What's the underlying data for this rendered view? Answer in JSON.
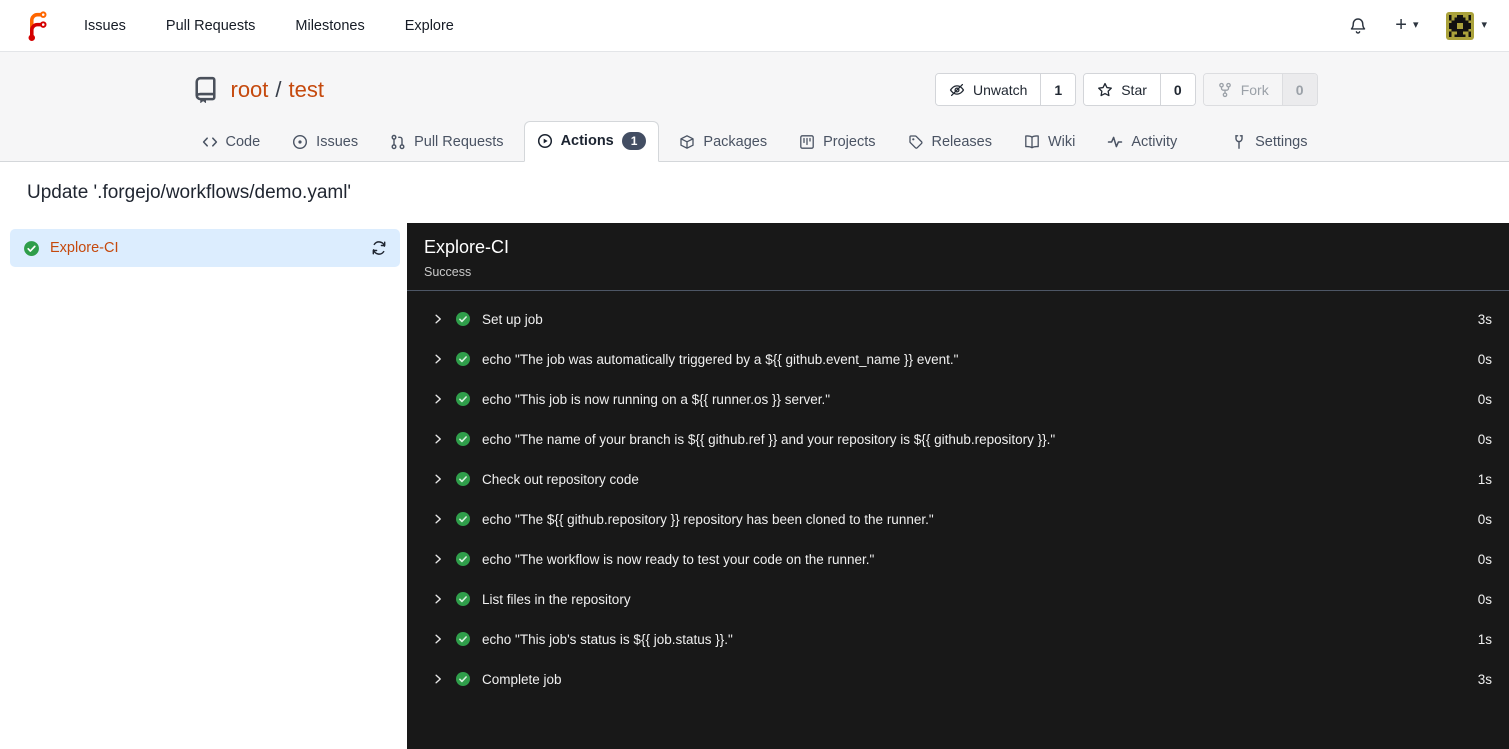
{
  "navbar": {
    "links": {
      "issues": "Issues",
      "pull_requests": "Pull Requests",
      "milestones": "Milestones",
      "explore": "Explore"
    }
  },
  "icons": {
    "plus": "+",
    "caret_down": "▾",
    "logo": "forgejo-logo",
    "bell": "notifications-bell",
    "avatar": "user-identicon"
  },
  "repo_header": {
    "owner": "root",
    "slash": "/",
    "name": "test",
    "unwatch": {
      "label": "Unwatch",
      "count": "1"
    },
    "star": {
      "label": "Star",
      "count": "0"
    },
    "fork": {
      "label": "Fork",
      "count": "0"
    }
  },
  "tabs": {
    "code": "Code",
    "issues": "Issues",
    "pull_requests": "Pull Requests",
    "actions": "Actions",
    "actions_badge": "1",
    "packages": "Packages",
    "projects": "Projects",
    "releases": "Releases",
    "wiki": "Wiki",
    "activity": "Activity",
    "settings": "Settings"
  },
  "page": {
    "title": "Update '.forgejo/workflows/demo.yaml'"
  },
  "sidebar": {
    "job_name": "Explore-CI"
  },
  "panel": {
    "title": "Explore-CI",
    "status": "Success",
    "steps": [
      {
        "name": "Set up job",
        "duration": "3s"
      },
      {
        "name": "echo \"The job was automatically triggered by a ${{ github.event_name }} event.\"",
        "duration": "0s"
      },
      {
        "name": "echo \"This job is now running on a ${{ runner.os }} server.\"",
        "duration": "0s"
      },
      {
        "name": "echo \"The name of your branch is ${{ github.ref }} and your repository is ${{ github.repository }}.\"",
        "duration": "0s"
      },
      {
        "name": "Check out repository code",
        "duration": "1s"
      },
      {
        "name": "echo \"The ${{ github.repository }} repository has been cloned to the runner.\"",
        "duration": "0s"
      },
      {
        "name": "echo \"The workflow is now ready to test your code on the runner.\"",
        "duration": "0s"
      },
      {
        "name": "List files in the repository",
        "duration": "0s"
      },
      {
        "name": "echo \"This job's status is ${{ job.status }}.\"",
        "duration": "1s"
      },
      {
        "name": "Complete job",
        "duration": "3s"
      }
    ]
  },
  "colors": {
    "accent_orange": "#c5490d",
    "success_green": "#2f9e4a",
    "panel_background": "#181818",
    "selected_job_background": "#dcedfe",
    "badge_background": "#434e63"
  }
}
